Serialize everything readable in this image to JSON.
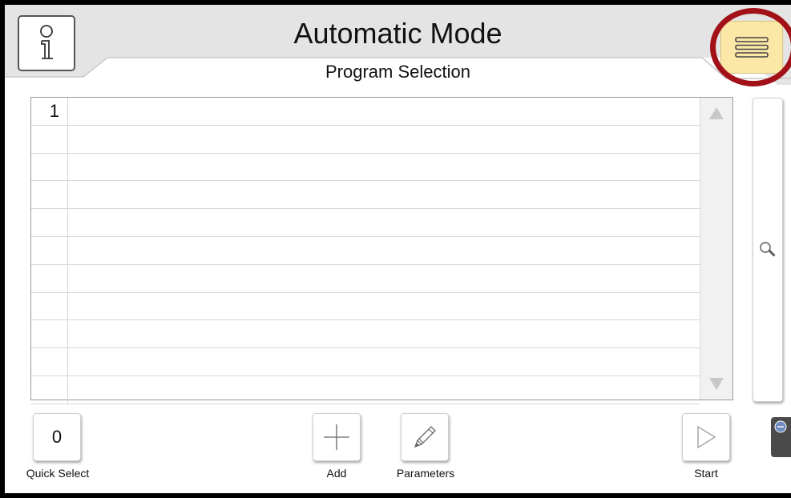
{
  "header": {
    "title": "Automatic Mode",
    "subtitle": "Program Selection"
  },
  "toolbar": {
    "info_icon": "info-icon",
    "menu_icon": "hamburger-menu-icon"
  },
  "program_list": {
    "rows": [
      "1",
      "",
      "",
      "",
      "",
      "",
      "",
      "",
      "",
      "",
      ""
    ]
  },
  "sidebar": {
    "search_icon": "magnifier-icon"
  },
  "footer": {
    "quick_select_value": "0",
    "quick_select_label": "Quick Select",
    "add_label": "Add",
    "parameters_label": "Parameters",
    "start_label": "Start"
  },
  "colors": {
    "menu_highlight": "#fbe7a6",
    "annotation_ring": "#a21018"
  }
}
